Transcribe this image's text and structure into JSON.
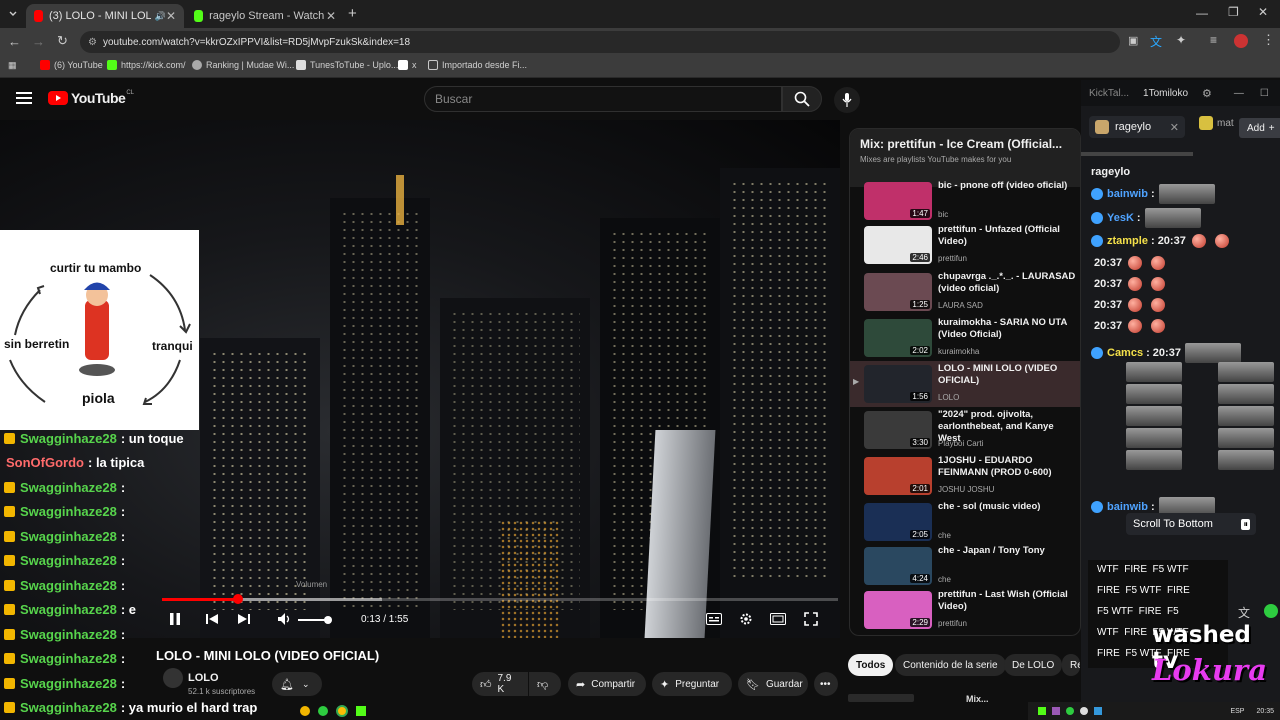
{
  "browser": {
    "tabs": [
      {
        "title": "(3) LOLO - MINI LOLO (VID"
      },
      {
        "title": "rageylo Stream - Watch Live on"
      }
    ],
    "url": "youtube.com/watch?v=kkrOZxIPPVI&list=RD5jMvpFzukSk&index=18",
    "bookmarks": [
      {
        "label": "(6) YouTube",
        "color": "#ff0000"
      },
      {
        "label": "https://kick.com/",
        "color": "#53fc18"
      },
      {
        "label": "Ranking | Mudae Wi...",
        "color": "#aaaaaa"
      },
      {
        "label": "TunesToTube - Uplo...",
        "color": "#dddddd"
      },
      {
        "label": "x",
        "color": "#ffffff"
      },
      {
        "label": "Importado desde Fi...",
        "color": "#c8c8c8"
      }
    ]
  },
  "youtube": {
    "logo_text": "YouTube",
    "country": "CL",
    "search_placeholder": "Buscar",
    "player": {
      "time": "0:13 / 1:55",
      "volume_tooltip": "Volumen",
      "progress_fraction": 0.113
    },
    "video_title": "LOLO - MINI LOLO (VIDEO OFICIAL)",
    "channel": "LOLO",
    "subscribers": "52.1 k suscriptores",
    "likes": "7.9 K",
    "actions": {
      "share": "Compartir",
      "ask": "Preguntar",
      "save": "Guardar"
    },
    "filter_chips": [
      "Todos",
      "Contenido de la serie",
      "De LOLO",
      "Re"
    ],
    "below_text": "Mix..."
  },
  "meme": {
    "top": "curtir tu mambo",
    "left": "sin berretin",
    "right": "tranqui",
    "bottom": "piola"
  },
  "overlay_chat": [
    {
      "user": "Swagginhaze28",
      "msg": ": un toque"
    },
    {
      "user": "SonOfGordo",
      "msg": ": la tipica"
    },
    {
      "user": "Swagginhaze28",
      "msg": ":"
    },
    {
      "user": "Swagginhaze28",
      "msg": ":"
    },
    {
      "user": "Swagginhaze28",
      "msg": ":"
    },
    {
      "user": "Swagginhaze28",
      "msg": ":"
    },
    {
      "user": "Swagginhaze28",
      "msg": ":"
    },
    {
      "user": "Swagginhaze28",
      "msg": ": e"
    },
    {
      "user": "Swagginhaze28",
      "msg": ":"
    },
    {
      "user": "Swagginhaze28",
      "msg": ":"
    },
    {
      "user": "Swagginhaze28",
      "msg": ":"
    },
    {
      "user": "Swagginhaze28",
      "msg": ": ya murio el hard trap"
    }
  ],
  "playlist": {
    "title": "Mix: prettifun - Ice Cream (Official...",
    "subtitle": "Mixes are playlists YouTube makes for you",
    "items": [
      {
        "title": "bic - pnone off (video oficial)",
        "channel": "bic",
        "duration": "1:47",
        "color": "#c0306a"
      },
      {
        "title": "prettifun - Unfazed (Official Video)",
        "channel": "prettifun",
        "duration": "2:46",
        "color": "#e8e8e8"
      },
      {
        "title": "chupavrga ._.*._. - LAURASAD (video oficial)",
        "channel": "LAURA SAD",
        "duration": "1:25",
        "color": "#6b4a52"
      },
      {
        "title": "kuraimokha - SARIA NO UTA (Video Oficial)",
        "channel": "kuraimokha",
        "duration": "2:02",
        "color": "#2e4a3a"
      },
      {
        "title": "LOLO - MINI LOLO (VIDEO OFICIAL)",
        "channel": "LOLO",
        "duration": "1:56",
        "color": "#22252c"
      },
      {
        "title": "\"2024\" prod. ojivolta, earlonthebeat, and Kanye West",
        "channel": "Playboi Carti",
        "duration": "3:30",
        "color": "#3a3a3a"
      },
      {
        "title": "1JOSHU - EDUARDO FEINMANN (PROD 0-600)",
        "channel": "JOSHU JOSHU",
        "duration": "2:01",
        "color": "#b8402e"
      },
      {
        "title": "che - sol (music video)",
        "channel": "che",
        "duration": "2:05",
        "color": "#1a2f55"
      },
      {
        "title": "che - Japan / Tony Tony",
        "channel": "che",
        "duration": "4:24",
        "color": "#2a4860"
      },
      {
        "title": "prettifun - Last Wish (Official Video)",
        "channel": "prettifun",
        "duration": "2:29",
        "color": "#d860c0"
      }
    ]
  },
  "kick": {
    "tabs": [
      "KickTal...",
      "1Tomiloko"
    ],
    "channel_tab": "rageylo",
    "channel_tab2": "mat",
    "add": "Add",
    "channel_header": "rageylo",
    "messages": [
      {
        "user": "bainwib",
        "text": ":",
        "color": "#4fa3ff"
      },
      {
        "user": "YesK",
        "text": ":",
        "color": "#4fa3ff"
      },
      {
        "user": "ztample",
        "text": ": 20:37",
        "color": "#f4e04a"
      },
      {
        "user": "",
        "text": "20:37",
        "color": "#ffffff"
      },
      {
        "user": "",
        "text": "20:37",
        "color": "#ffffff"
      },
      {
        "user": "",
        "text": "20:37",
        "color": "#ffffff"
      },
      {
        "user": "",
        "text": "20:37",
        "color": "#ffffff"
      },
      {
        "user": "Camcs",
        "text": ": 20:37",
        "color": "#f4e04a"
      },
      {
        "user": "bainwib",
        "text": ":",
        "color": "#4fa3ff"
      }
    ],
    "scroll_to_bottom": "Scroll To Bottom",
    "fire_lines": [
      "WTF  FIRE  F5 WTF",
      "FIRE  F5 WTF  FIRE",
      "F5 WTF  FIRE  F5",
      "WTF  FIRE  F5 WTF",
      "FIRE  F5 WTF  FIRE"
    ],
    "watermark_top": "washed tv",
    "watermark_bottom": "Lokura"
  },
  "taskbar": {
    "lang": "ESP",
    "time": "20:35"
  }
}
